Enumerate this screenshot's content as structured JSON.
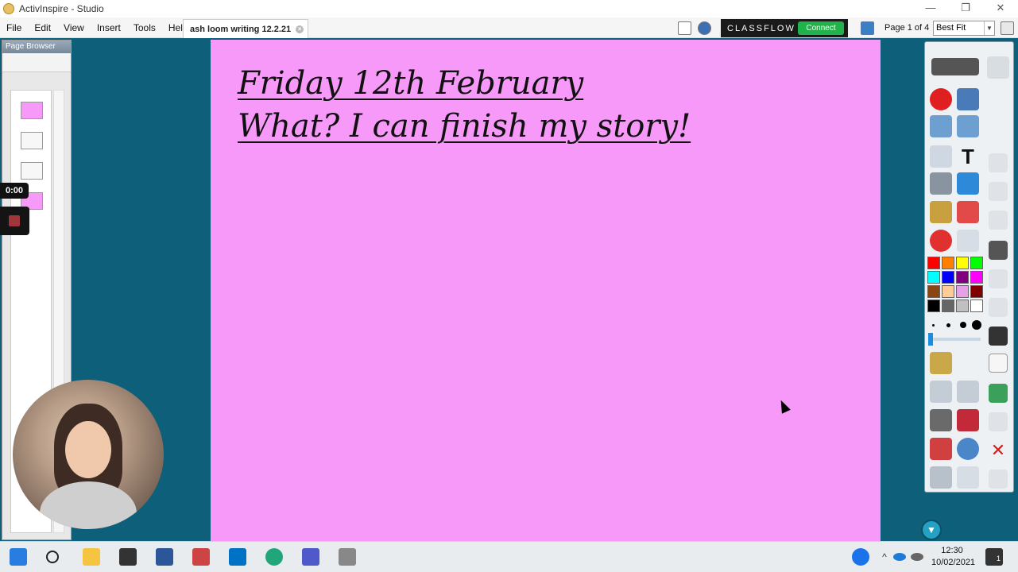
{
  "window": {
    "title": "ActivInspire - Studio",
    "controls": [
      "—",
      "❐",
      "✕"
    ]
  },
  "menu": [
    "File",
    "Edit",
    "View",
    "Insert",
    "Tools",
    "Help"
  ],
  "document_tab": {
    "label": "ash loom writing 12.2.21"
  },
  "classflow": {
    "logo": "CLASSFLOW",
    "connect_label": "Connect"
  },
  "page_indicator": "Page 1 of 4",
  "zoom": {
    "selected": "Best Fit"
  },
  "page_browser": {
    "title": "Page Browser"
  },
  "recording": {
    "time": "0:00"
  },
  "flipchart": {
    "background": "#f799f9",
    "lines": [
      "Friday 12th February",
      "What? I can finish my story!"
    ]
  },
  "palette": {
    "colors": [
      "#ff0000",
      "#ff8000",
      "#ffff00",
      "#00ff00",
      "#00ffff",
      "#0000ff",
      "#800080",
      "#ff00ff",
      "#8b4513",
      "#ffcc99",
      "#e6a0e6",
      "#800000",
      "#000000",
      "#666666",
      "#c0c0c0",
      "#ffffff"
    ]
  },
  "taskbar": {
    "time": "12:30",
    "date": "10/02/2021",
    "notification_count": "1"
  }
}
